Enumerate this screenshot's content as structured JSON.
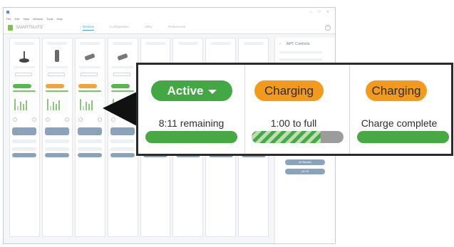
{
  "window": {
    "title": "SMARTSUITE",
    "menu": [
      "File",
      "Edit",
      "View",
      "Window",
      "Tools",
      "Help"
    ],
    "tabs": [
      {
        "label": "Devices"
      },
      {
        "label": "Configuration"
      },
      {
        "label": "Utility"
      },
      {
        "label": "Preferences"
      }
    ]
  },
  "channel_count": 8,
  "side_panel": {
    "title": "APT Controls",
    "buttons": [
      "All Standby",
      "All Off"
    ]
  },
  "zoom": {
    "cells": [
      {
        "chip_label": "Active",
        "chip_kind": "active",
        "has_dropdown": true,
        "status": "8:11 remaining",
        "charge_fraction": 1.0,
        "striped": false
      },
      {
        "chip_label": "Charging",
        "chip_kind": "charging",
        "has_dropdown": false,
        "status": "1:00 to full",
        "charge_fraction": 0.75,
        "striped": true
      },
      {
        "chip_label": "Charging",
        "chip_kind": "charging",
        "has_dropdown": false,
        "status": "Charge complete",
        "charge_fraction": 1.0,
        "striped": false
      }
    ]
  },
  "colors": {
    "active": "#43a843",
    "charging": "#f39a1c",
    "meter_fill": "#48a843",
    "meter_track": "#9c9c9c",
    "callout_border": "#2a2a2a"
  }
}
